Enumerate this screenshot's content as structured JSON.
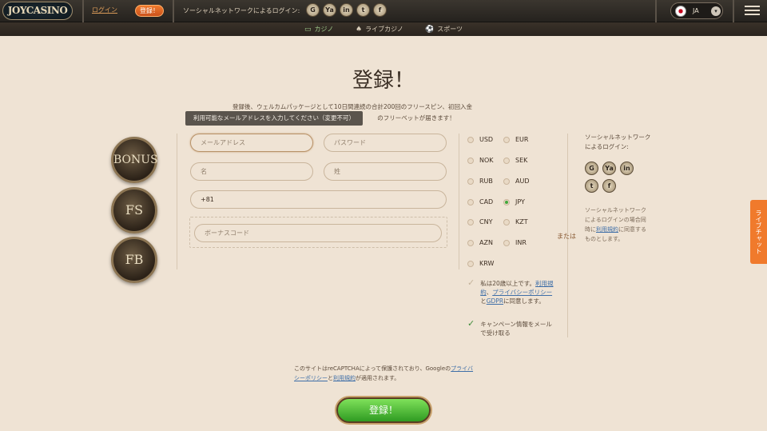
{
  "header": {
    "logo": "JOYCASINO",
    "login": "ログイン",
    "register": "登録！",
    "social_label": "ソーシャルネットワークによるログイン:",
    "social_icons": [
      {
        "name": "google-icon",
        "glyph": "G"
      },
      {
        "name": "yandex-icon",
        "glyph": "Ya"
      },
      {
        "name": "linkedin-icon",
        "glyph": "in"
      },
      {
        "name": "tumblr-icon",
        "glyph": "t"
      },
      {
        "name": "facebook-icon",
        "glyph": "f"
      }
    ],
    "language": "JA"
  },
  "subnav": {
    "casino": "カジノ",
    "live_casino": "ライブカジノ",
    "sports": "スポーツ"
  },
  "main": {
    "title": "登録！",
    "intro_line1": "登録後、ウェルカムパッケージとして10日間連続の合計200回のフリースピン、初回入金",
    "intro_line2": "のフリーベットが届きます！",
    "tooltip": "利用可能なメールアドレスを入力してください（変更不可）",
    "badges": [
      "BONUS",
      "FS",
      "FB"
    ],
    "fields": {
      "email_placeholder": "メールアドレス",
      "password_placeholder": "パスワード",
      "first_name_placeholder": "名",
      "last_name_placeholder": "姓",
      "phone_value": "+81",
      "bonus_code_placeholder": "ボーナスコード"
    },
    "currencies": [
      {
        "code": "USD",
        "checked": false
      },
      {
        "code": "EUR",
        "checked": false
      },
      {
        "code": "NOK",
        "checked": false
      },
      {
        "code": "SEK",
        "checked": false
      },
      {
        "code": "RUB",
        "checked": false
      },
      {
        "code": "AUD",
        "checked": false
      },
      {
        "code": "CAD",
        "checked": false
      },
      {
        "code": "JPY",
        "checked": true
      },
      {
        "code": "CNY",
        "checked": false
      },
      {
        "code": "KZT",
        "checked": false
      },
      {
        "code": "AZN",
        "checked": false
      },
      {
        "code": "INR",
        "checked": false
      },
      {
        "code": "KRW",
        "checked": false
      }
    ],
    "age_check": {
      "text_a": "私は20歳以上です。",
      "link_terms": "利用規約",
      "text_b": "、",
      "link_privacy": "プライバシーポリシー",
      "text_c": "と",
      "link_gdpr": "GDPR",
      "text_d": "に同意します。"
    },
    "campaign_check": "キャンペーン情報をメールで受け取る",
    "or": "または",
    "right_social_title": "ソーシャルネットワークによるログイン:",
    "right_note_a": "ソーシャルネットワークによるログインの場合同時に",
    "right_note_link": "利用規約",
    "right_note_b": "に同意するものとします。",
    "recaptcha_a": "このサイトはreCAPTCHAによって保護されており、Googleの",
    "recaptcha_privacy": "プライバシーポリシー",
    "recaptcha_b": "と",
    "recaptcha_terms": "利用規約",
    "recaptcha_c": "が適用されます。",
    "submit": "登録！",
    "live_chat": "ライブチャット"
  }
}
